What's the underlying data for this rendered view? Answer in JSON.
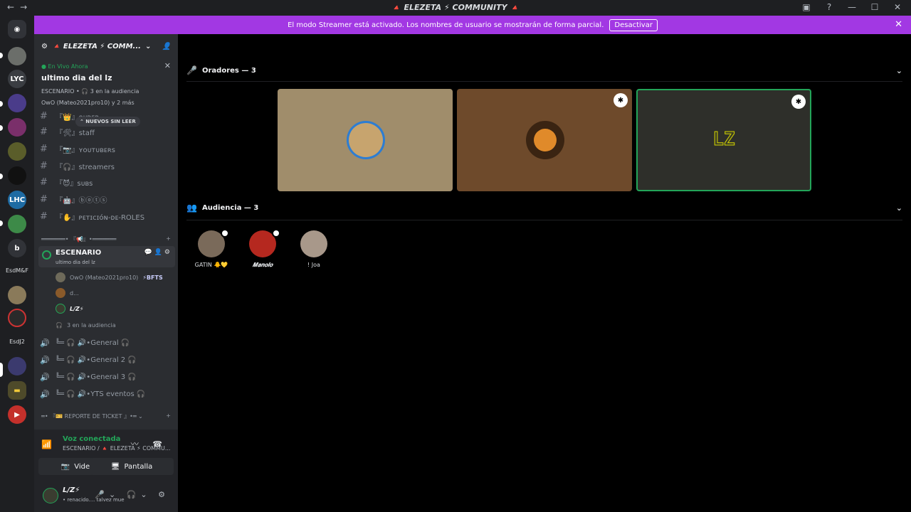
{
  "titlebar": {
    "back": "←",
    "forward": "→",
    "title": "🔺 ELEZETA ⚡ COMMUNITY 🔺"
  },
  "banner": {
    "text": "El modo Streamer está activado. Los nombres de usuario se mostrarán de forma parcial.",
    "button": "Desactivar",
    "close": "✕"
  },
  "servers": {
    "labels": [
      "LYC",
      "LHC",
      "b",
      "EsdM&F",
      "EsdJ2"
    ]
  },
  "guild": {
    "name": "🔺 ELEZETA ⚡ COMM...",
    "chevron": "⌄"
  },
  "live": {
    "badge": "● En Vivo Ahora",
    "title": "ultimo dia del lz",
    "meta": "ESCENARIO • 🎧 3 en la audiencia",
    "users": "OwO (Mateo2021pro10) y 2 más",
    "close": "✕"
  },
  "channels": [
    {
      "name": "『👑』ᴏᴜᴅᴇʀ"
    },
    {
      "name": "『🛠』staff"
    },
    {
      "name": "『📷』ʏᴏᴜᴛᴜʙᴇʀꜱ"
    },
    {
      "name": "『🎧』streamers"
    },
    {
      "name": "『😈』ꜱᴜʙꜱ"
    },
    {
      "name": "『🤖』ⓑⓞⓣⓢ"
    },
    {
      "name": "『✋』ᴘᴇᴛɪᴄɪóɴ-ᴅᴇ-ROLES"
    }
  ],
  "unread_pill": "⌃ NUEVOS SIN LEER",
  "category1": "═══════• 『📢』•═══════",
  "stage": {
    "name": "ESCENARIO",
    "subtitle": "ultimo dia del lz"
  },
  "stage_members": [
    {
      "name": "OwO (Mateo2021pro10)",
      "tag": "⚡BFTS"
    },
    {
      "name": "d...",
      "tag": ""
    },
    {
      "name": "L/Z⚡",
      "tag": ""
    }
  ],
  "audience_count": "3 en la audiencia",
  "voice_channels": [
    {
      "name": "╚═ 🎧 🔊•General 🎧"
    },
    {
      "name": "╚═ 🎧 🔊•General 2 🎧"
    },
    {
      "name": "╚═ 🎧 🔊•General 3 🎧"
    },
    {
      "name": "╚═ 🎧 🔊•YTS eventos 🎧"
    }
  ],
  "category2": "═• 『🎫 REPORTE DE TICKET 』•═ ⌄",
  "voice_panel": {
    "status": "Voz conectada",
    "location": "ESCENARIO / 🔺 ELEZETA ⚡ COMMU...",
    "video": "Video",
    "screen": "Pantalla"
  },
  "user": {
    "name": "L/Z⚡",
    "status": "• renacido.... talvez mue"
  },
  "speakers": {
    "label": "Oradores — 3"
  },
  "speaker_tiles": [
    {
      "kind": "avatar",
      "color": "#a08d6b"
    },
    {
      "kind": "avatar",
      "color": "#6e4a2b"
    },
    {
      "kind": "text",
      "text": "LZ",
      "color": "#2e2f2a"
    }
  ],
  "audience": {
    "label": "Audiencia — 3"
  },
  "audience_members": [
    {
      "name": "GATIN 🐥💛"
    },
    {
      "name": "𝑴𝒂𝒏𝒐𝒍𝒐"
    },
    {
      "name": "! Joa"
    }
  ]
}
